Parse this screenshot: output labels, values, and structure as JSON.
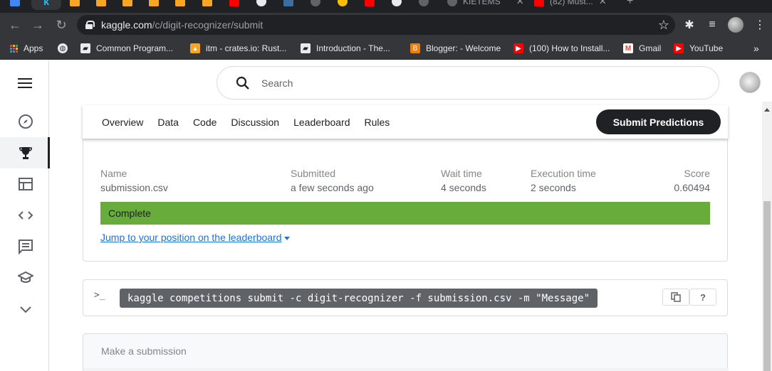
{
  "browser": {
    "tabs": [
      {
        "title": "",
        "favicon_color": "#1a73e8"
      },
      {
        "title": "",
        "favicon_color": "#20beff"
      },
      {
        "title": "",
        "favicon_color": "#f6a623"
      },
      {
        "title": "KIETEMS",
        "favicon_color": "#5f6368"
      },
      {
        "title": "(82) Must...",
        "favicon_color": "#ff0000"
      }
    ],
    "url_host": "kaggle.com",
    "url_path": "/c/digit-recognizer/submit"
  },
  "bookmarks": [
    {
      "label": "Apps",
      "icon": "apps-grid-icon"
    },
    {
      "label": "",
      "icon": "globe-icon"
    },
    {
      "label": "Common Program...",
      "icon": "notebook-icon"
    },
    {
      "label": "itm - crates.io: Rust...",
      "icon": "crates-icon"
    },
    {
      "label": "Introduction - The...",
      "icon": "notebook-icon"
    },
    {
      "label": "Blogger: - Welcome",
      "icon": "blogger-icon"
    },
    {
      "label": "(100) How to Install...",
      "icon": "youtube-icon"
    },
    {
      "label": "Gmail",
      "icon": "gmail-icon"
    },
    {
      "label": "YouTube",
      "icon": "youtube-icon"
    }
  ],
  "more_bookmarks": "»",
  "search": {
    "placeholder": "Search"
  },
  "competition_tabs": [
    "Overview",
    "Data",
    "Code",
    "Discussion",
    "Leaderboard",
    "Rules"
  ],
  "submit_button": "Submit Predictions",
  "submission": {
    "name_header": "Name",
    "name_value": "submission.csv",
    "submitted_header": "Submitted",
    "submitted_value": "a few seconds ago",
    "wait_header": "Wait time",
    "wait_value": "4 seconds",
    "exec_header": "Execution time",
    "exec_value": "2 seconds",
    "score_header": "Score",
    "score_value": "0.60494",
    "status": "Complete",
    "jump_link": "Jump to your position on the leaderboard"
  },
  "api": {
    "prompt": ">_",
    "command": "kaggle competitions submit -c digit-recognizer -f submission.csv -m \"Message\"",
    "help": "?"
  },
  "make_submission": "Make a submission",
  "colors": {
    "success": "#68ad3b",
    "link": "#1a73e8",
    "dark": "#202124"
  }
}
